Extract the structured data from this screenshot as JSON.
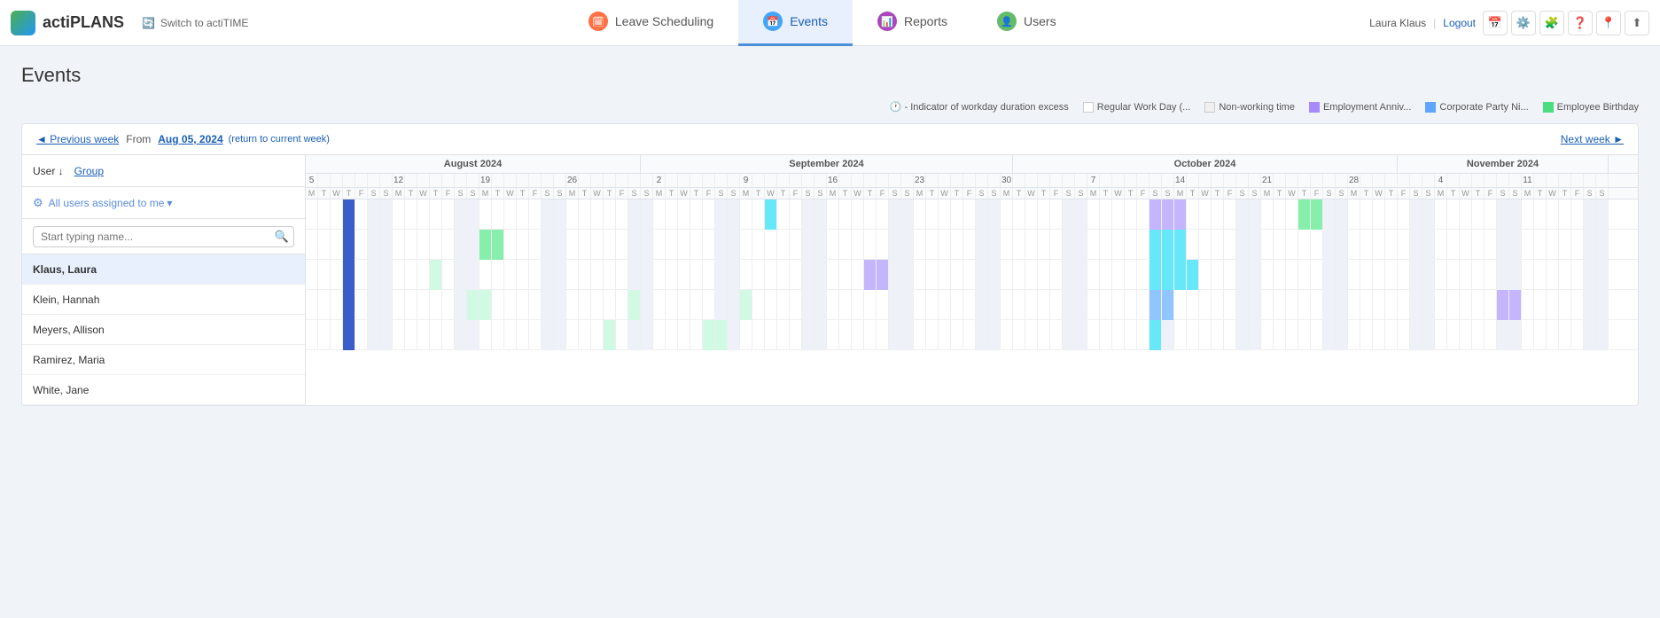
{
  "app": {
    "logo": "actiPLANS",
    "switch_label": "Switch to actiTIME"
  },
  "nav": {
    "tabs": [
      {
        "id": "leave",
        "label": "Leave Scheduling",
        "icon": "🗓",
        "icon_class": "icon-leave"
      },
      {
        "id": "events",
        "label": "Events",
        "icon": "📅",
        "icon_class": "icon-events",
        "active": true
      },
      {
        "id": "reports",
        "label": "Reports",
        "icon": "📊",
        "icon_class": "icon-reports"
      },
      {
        "id": "users",
        "label": "Users",
        "icon": "👤",
        "icon_class": "icon-users"
      }
    ],
    "user": "Laura Klaus",
    "logout": "Logout"
  },
  "indicator": "- Indicator of workday duration excess",
  "legend": [
    {
      "id": "work",
      "label": "Regular Work Day (...",
      "class": "work"
    },
    {
      "id": "nonwork",
      "label": "Non-working time",
      "class": "nonwork"
    },
    {
      "id": "anniv",
      "label": "Employment Anniv...",
      "class": "anniv"
    },
    {
      "id": "corporate",
      "label": "Corporate Party Ni...",
      "class": "corporate"
    },
    {
      "id": "birthday",
      "label": "Employee Birthday",
      "class": "birthday"
    }
  ],
  "calendar": {
    "prev_label": "◄ Previous week",
    "next_label": "Next week ►",
    "from_label": "From",
    "current_date": "Aug 05, 2024",
    "return_label": "(return to current week)"
  },
  "sidebar": {
    "user_sort": "User ↓",
    "group_link": "Group",
    "filter_label": "All users assigned to me",
    "search_placeholder": "Start typing name...",
    "users": [
      {
        "name": "Klaus, Laura",
        "highlighted": true
      },
      {
        "name": "Klein, Hannah",
        "highlighted": false
      },
      {
        "name": "Meyers, Allison",
        "highlighted": false
      },
      {
        "name": "Ramirez, Maria",
        "highlighted": false
      },
      {
        "name": "White, Jane",
        "highlighted": false
      }
    ]
  },
  "months": [
    {
      "label": "August 2024",
      "cols": 27
    },
    {
      "label": "September 2024",
      "cols": 26
    },
    {
      "label": "October 2024",
      "cols": 27
    },
    {
      "label": "November 2024",
      "cols": 14
    }
  ]
}
